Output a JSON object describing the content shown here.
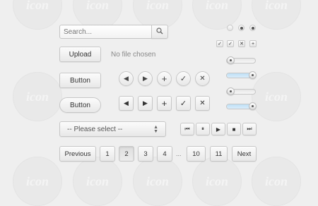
{
  "search": {
    "placeholder": "Search...",
    "button_icon": "search-icon"
  },
  "upload": {
    "button_label": "Upload",
    "status_text": "No file chosen"
  },
  "buttons": {
    "button_1_label": "Button",
    "button_2_label": "Button"
  },
  "icon_row_round": [
    {
      "name": "prev",
      "glyph": "◀"
    },
    {
      "name": "next",
      "glyph": "▶"
    },
    {
      "name": "add",
      "glyph": "+"
    },
    {
      "name": "check",
      "glyph": "✓"
    },
    {
      "name": "close",
      "glyph": "✕"
    }
  ],
  "icon_row_square": [
    {
      "name": "prev",
      "glyph": "◀"
    },
    {
      "name": "next",
      "glyph": "▶"
    },
    {
      "name": "add",
      "glyph": "+"
    },
    {
      "name": "check",
      "glyph": "✓"
    },
    {
      "name": "close",
      "glyph": "✕"
    }
  ],
  "radios": [
    false,
    true,
    true
  ],
  "checkboxes": [
    {
      "glyph": "✓"
    },
    {
      "glyph": "✓"
    },
    {
      "glyph": "✕"
    },
    {
      "glyph": "+"
    }
  ],
  "sliders": [
    {
      "value": 0.0
    },
    {
      "value": 1.0
    },
    {
      "value": 0.0
    },
    {
      "value": 1.0
    }
  ],
  "select": {
    "selected": "-- Please select --"
  },
  "media_controls": [
    {
      "name": "previous-track",
      "glyph": "⏮"
    },
    {
      "name": "pause",
      "glyph": "⏸"
    },
    {
      "name": "play",
      "glyph": "▶"
    },
    {
      "name": "stop",
      "glyph": "■"
    },
    {
      "name": "next-track",
      "glyph": "⏭"
    }
  ],
  "pagination": {
    "previous": "Previous",
    "pages": [
      "1",
      "2",
      "3",
      "4"
    ],
    "ellipsis": "...",
    "tail_pages": [
      "10",
      "11"
    ],
    "next": "Next",
    "active": "2"
  },
  "watermark_text": "icon"
}
